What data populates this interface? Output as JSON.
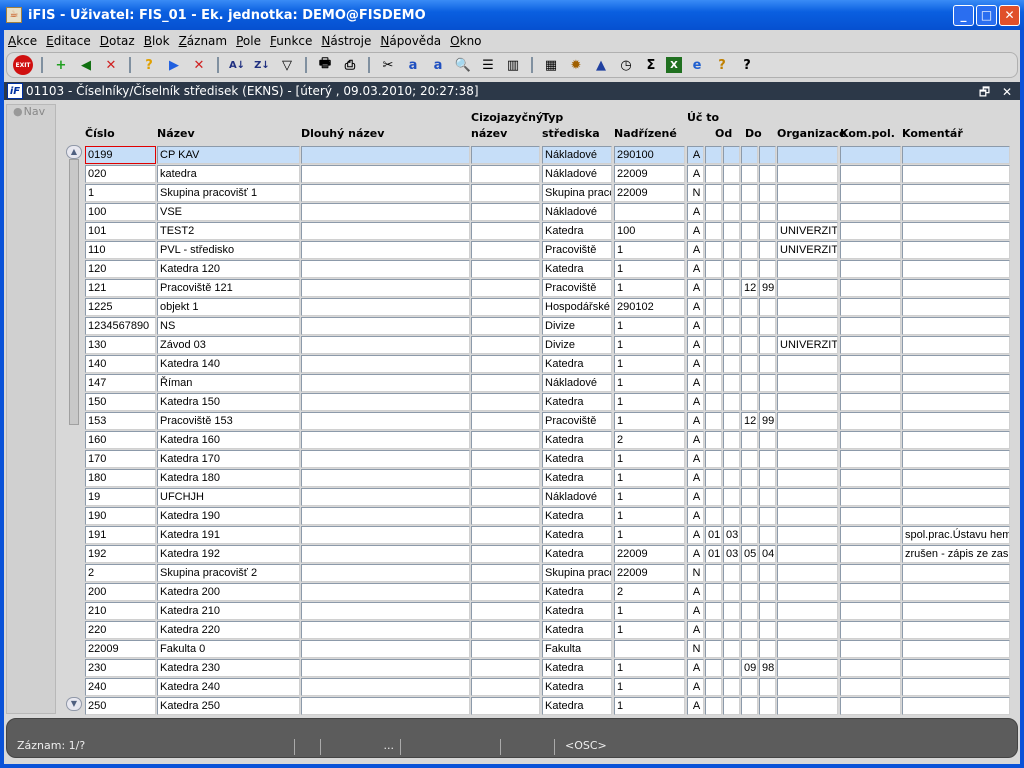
{
  "window": {
    "title": "iFIS - Uživatel: FIS_01 - Ek. jednotka: DEMO@FISDEMO",
    "min": "_",
    "max": "□",
    "close": "✕"
  },
  "menu": [
    "Akce",
    "Editace",
    "Dotaz",
    "Blok",
    "Záznam",
    "Pole",
    "Funkce",
    "Nástroje",
    "Nápověda",
    "Okno"
  ],
  "toolbar": {
    "exit": "EXIT"
  },
  "form": {
    "title": "01103 - Číselníky/Číselník středisek (EKNS) - [úterý  , 09.03.2010; 20:27:38]",
    "icon_text": "iF",
    "restore": "🗗",
    "close": "✕"
  },
  "nav": {
    "label": "Nav"
  },
  "columns": [
    "Číslo",
    "Název",
    "Dlouhý název",
    "Cizojazyčný název",
    "Typ střediska",
    "Nadřízené",
    "Úč to",
    "Od",
    "Do",
    "Organizace",
    "Kom.pol.",
    "Komentář"
  ],
  "rows": [
    [
      "0199",
      "CP KAV",
      "",
      "",
      "Nákladové",
      "290100",
      "A",
      "",
      "",
      "",
      "",
      "",
      "",
      ""
    ],
    [
      "020",
      "katedra",
      "",
      "",
      "Nákladové",
      "22009",
      "A",
      "",
      "",
      "",
      "",
      "",
      "",
      ""
    ],
    [
      "1",
      "Skupina pracovišť 1",
      "",
      "",
      "Skupina pracc",
      "22009",
      "N",
      "",
      "",
      "",
      "",
      "",
      "",
      ""
    ],
    [
      "100",
      "VSE",
      "",
      "",
      "Nákladové",
      "",
      "A",
      "",
      "",
      "",
      "",
      "",
      "",
      ""
    ],
    [
      "101",
      "TEST2",
      "",
      "",
      "Katedra",
      "100",
      "A",
      "",
      "",
      "",
      "",
      "UNIVERZITA",
      "",
      ""
    ],
    [
      "110",
      "PVL - středisko",
      "",
      "",
      "Pracoviště",
      "1",
      "A",
      "",
      "",
      "",
      "",
      "UNIVERZITA",
      "",
      ""
    ],
    [
      "120",
      "Katedra 120",
      "",
      "",
      "Katedra",
      "1",
      "A",
      "",
      "",
      "",
      "",
      "",
      "",
      ""
    ],
    [
      "121",
      "Pracoviště 121",
      "",
      "",
      "Pracoviště",
      "1",
      "A",
      "",
      "",
      "12",
      "99",
      "",
      "",
      ""
    ],
    [
      "1225",
      "objekt 1",
      "",
      "",
      "Hospodářské",
      "290102",
      "A",
      "",
      "",
      "",
      "",
      "",
      "",
      ""
    ],
    [
      "1234567890",
      "NS",
      "",
      "",
      "Divize",
      "1",
      "A",
      "",
      "",
      "",
      "",
      "",
      "",
      ""
    ],
    [
      "130",
      "Závod 03",
      "",
      "",
      "Divize",
      "1",
      "A",
      "",
      "",
      "",
      "",
      "UNIVERZITA",
      "",
      ""
    ],
    [
      "140",
      "Katedra 140",
      "",
      "",
      "Katedra",
      "1",
      "A",
      "",
      "",
      "",
      "",
      "",
      "",
      ""
    ],
    [
      "147",
      "Říman",
      "",
      "",
      "Nákladové",
      "1",
      "A",
      "",
      "",
      "",
      "",
      "",
      "",
      ""
    ],
    [
      "150",
      "Katedra 150",
      "",
      "",
      "Katedra",
      "1",
      "A",
      "",
      "",
      "",
      "",
      "",
      "",
      ""
    ],
    [
      "153",
      "Pracoviště 153",
      "",
      "",
      "Pracoviště",
      "1",
      "A",
      "",
      "",
      "12",
      "99",
      "",
      "",
      ""
    ],
    [
      "160",
      "Katedra 160",
      "",
      "",
      "Katedra",
      "2",
      "A",
      "",
      "",
      "",
      "",
      "",
      "",
      ""
    ],
    [
      "170",
      "Katedra 170",
      "",
      "",
      "Katedra",
      "1",
      "A",
      "",
      "",
      "",
      "",
      "",
      "",
      ""
    ],
    [
      "180",
      "Katedra 180",
      "",
      "",
      "Katedra",
      "1",
      "A",
      "",
      "",
      "",
      "",
      "",
      "",
      ""
    ],
    [
      "19",
      "UFCHJH",
      "",
      "",
      "Nákladové",
      "1",
      "A",
      "",
      "",
      "",
      "",
      "",
      "",
      ""
    ],
    [
      "190",
      "Katedra 190",
      "",
      "",
      "Katedra",
      "1",
      "A",
      "",
      "",
      "",
      "",
      "",
      "",
      ""
    ],
    [
      "191",
      "Katedra 191",
      "",
      "",
      "Katedra",
      "1",
      "A",
      "01",
      "03",
      "",
      "",
      "",
      "",
      "spol.prac.Ústavu hem"
    ],
    [
      "192",
      "Katedra 192",
      "",
      "",
      "Katedra",
      "22009",
      "A",
      "01",
      "03",
      "05",
      "04",
      "",
      "",
      "zrušen - zápis ze zas"
    ],
    [
      "2",
      "Skupina pracovišť 2",
      "",
      "",
      "Skupina pracc",
      "22009",
      "N",
      "",
      "",
      "",
      "",
      "",
      "",
      ""
    ],
    [
      "200",
      "Katedra 200",
      "",
      "",
      "Katedra",
      "2",
      "A",
      "",
      "",
      "",
      "",
      "",
      "",
      ""
    ],
    [
      "210",
      "Katedra 210",
      "",
      "",
      "Katedra",
      "1",
      "A",
      "",
      "",
      "",
      "",
      "",
      "",
      ""
    ],
    [
      "220",
      "Katedra 220",
      "",
      "",
      "Katedra",
      "1",
      "A",
      "",
      "",
      "",
      "",
      "",
      "",
      ""
    ],
    [
      "22009",
      "Fakulta 0",
      "",
      "",
      "Fakulta",
      "",
      "N",
      "",
      "",
      "",
      "",
      "",
      "",
      ""
    ],
    [
      "230",
      "Katedra 230",
      "",
      "",
      "Katedra",
      "1",
      "A",
      "",
      "",
      "09",
      "98",
      "",
      "",
      ""
    ],
    [
      "240",
      "Katedra 240",
      "",
      "",
      "Katedra",
      "1",
      "A",
      "",
      "",
      "",
      "",
      "",
      "",
      ""
    ],
    [
      "250",
      "Katedra 250",
      "",
      "",
      "Katedra",
      "1",
      "A",
      "",
      "",
      "",
      "",
      "",
      "",
      ""
    ]
  ],
  "status": {
    "record": "Záznam: 1/?",
    "s2": "",
    "s3": "...",
    "s4": "",
    "s5": "<OSC>"
  }
}
